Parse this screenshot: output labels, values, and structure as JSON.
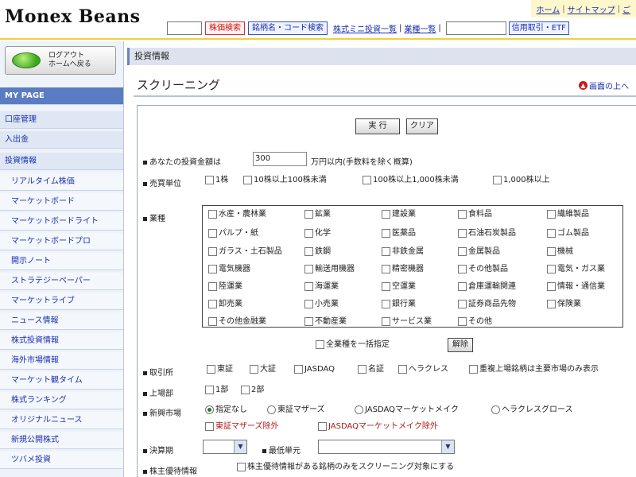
{
  "header": {
    "logo": "Monex Beans",
    "top_links": [
      "ホーム",
      "サイトマップ",
      "ご"
    ],
    "quick": {
      "btn_red": "株価検索",
      "btn_blue": "銘柄名・コード検索",
      "link1": "株式ミニ投資一覧",
      "link2": "業種一覧",
      "btn_right": "信用取引・ETF"
    }
  },
  "sidebar": {
    "logout_label": "ログアウト",
    "logout_sub": "ホームへ戻る",
    "items": [
      {
        "label": "MY PAGE",
        "kind": "mypage"
      },
      {
        "label": "口座管理",
        "kind": "section"
      },
      {
        "label": "入出金",
        "kind": "section"
      },
      {
        "label": "投資情報",
        "kind": "section"
      },
      {
        "label": "リアルタイム株価",
        "kind": "sub"
      },
      {
        "label": "マーケットボード",
        "kind": "sub"
      },
      {
        "label": "マーケットボードライト",
        "kind": "sub"
      },
      {
        "label": "マーケットボードプロ",
        "kind": "sub"
      },
      {
        "label": "開示ノート",
        "kind": "sub"
      },
      {
        "label": "ストラテジーペーパー",
        "kind": "sub"
      },
      {
        "label": "マーケットライブ",
        "kind": "sub"
      },
      {
        "label": "ニュース情報",
        "kind": "sub"
      },
      {
        "label": "株式投資情報",
        "kind": "sub"
      },
      {
        "label": "海外市場情報",
        "kind": "sub"
      },
      {
        "label": "マーケット観タイム",
        "kind": "sub"
      },
      {
        "label": "株式ランキング",
        "kind": "sub"
      },
      {
        "label": "オリジナルニュース",
        "kind": "sub"
      },
      {
        "label": "新規公開株式",
        "kind": "sub"
      },
      {
        "label": "ツバメ投資",
        "kind": "sub"
      }
    ]
  },
  "main": {
    "crumb": "投資情報",
    "title": "スクリーニング",
    "back_link": "画面の上へ",
    "btn_run": "実 行",
    "btn_clear": "クリア",
    "capital": {
      "label": "あなたの投資金額は",
      "value": "300",
      "suffix": "万円以内(手数料を除く概算)"
    },
    "volume": {
      "label": "売買単位",
      "options": [
        "1株",
        "10株以上100株未満",
        "100株以上1,000株未満",
        "1,000株以上"
      ]
    },
    "industry": {
      "label": "業種",
      "columns": [
        [
          "水産・農林業",
          "パルプ・紙",
          "ガラス・土石製品",
          "電気機器",
          "陸運業",
          "卸売業",
          "その他金融業"
        ],
        [
          "鉱業",
          "化学",
          "鉄鋼",
          "輸送用機器",
          "海運業",
          "小売業",
          "不動産業"
        ],
        [
          "建設業",
          "医薬品",
          "非鉄金属",
          "精密機器",
          "空運業",
          "銀行業",
          "サービス業"
        ],
        [
          "食料品",
          "石油石炭製品",
          "金属製品",
          "その他製品",
          "倉庫運輸関連",
          "証券商品先物",
          "その他"
        ],
        [
          "繊維製品",
          "ゴム製品",
          "機械",
          "電気・ガス業",
          "情報・通信業",
          "保険業"
        ]
      ],
      "select_all": "全業種を一括指定",
      "release": "解除"
    },
    "market": {
      "label": "取引所",
      "options": [
        "東証",
        "大証",
        "JASDAQ",
        "名証",
        "ヘラクレス",
        "重複上場銘柄は主要市場のみ表示"
      ]
    },
    "section": {
      "label": "上場部",
      "options": [
        "1部",
        "2部"
      ]
    },
    "new_market": {
      "label": "新興市場",
      "options": [
        "指定なし",
        "東証マザーズ",
        "JASDAQマーケットメイク",
        "ヘラクレスグロース"
      ],
      "options2": [
        "東証マザーズ除外",
        "JASDAQマーケットメイク除外"
      ]
    },
    "settle": {
      "label": "決算期",
      "label2": "最低単元"
    },
    "other": {
      "label": "株主優待情報",
      "option": "株主優待情報がある銘柄のみをスクリーニング対象にする"
    }
  }
}
